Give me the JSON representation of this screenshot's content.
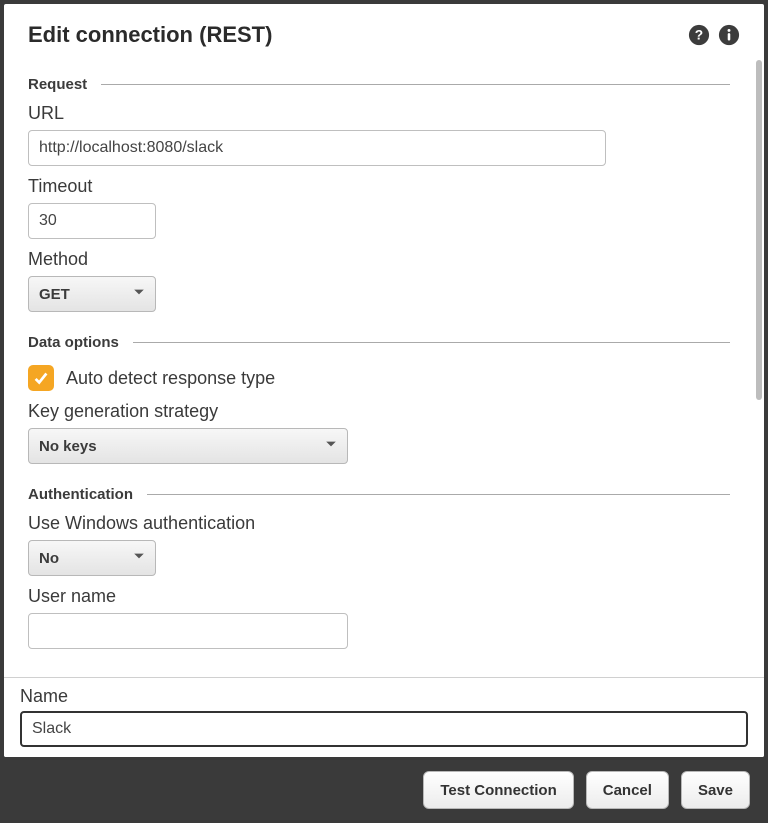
{
  "header": {
    "title": "Edit connection (REST)"
  },
  "sections": {
    "request": "Request",
    "data_options": "Data options",
    "authentication": "Authentication"
  },
  "fields": {
    "url_label": "URL",
    "url_value": "http://localhost:8080/slack",
    "timeout_label": "Timeout",
    "timeout_value": "30",
    "method_label": "Method",
    "method_value": "GET",
    "autodetect_label": "Auto detect response type",
    "autodetect_checked": true,
    "keygen_label": "Key generation strategy",
    "keygen_value": "No keys",
    "winauth_label": "Use Windows authentication",
    "winauth_value": "No",
    "username_label": "User name",
    "username_value": "",
    "name_label": "Name",
    "name_value": "Slack"
  },
  "buttons": {
    "test": "Test Connection",
    "cancel": "Cancel",
    "save": "Save"
  }
}
